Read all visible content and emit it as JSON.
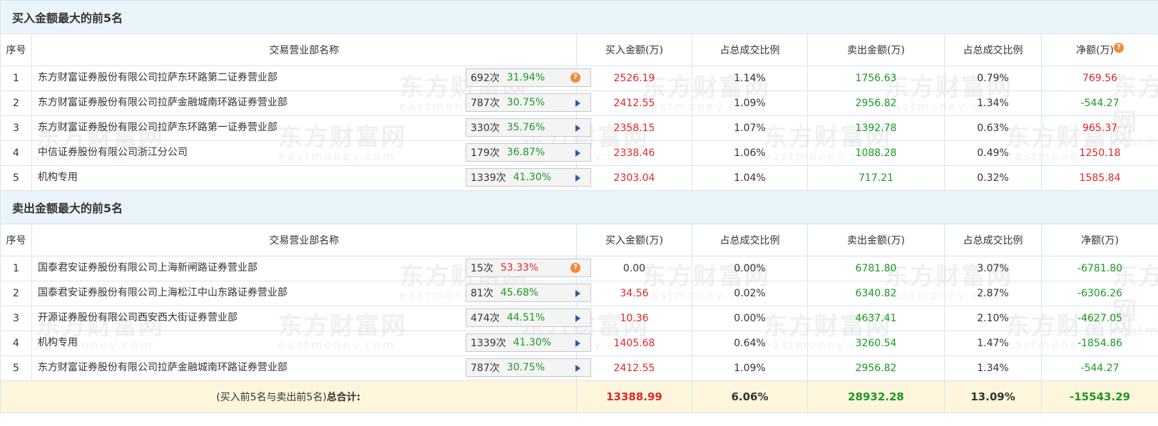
{
  "buy_section": {
    "title": "买入金额最大的前5名",
    "headers": [
      "序号",
      "交易营业部名称",
      "买入金额(万)",
      "占总成交比例",
      "卖出金额(万)",
      "占总成交比例",
      "净额(万)"
    ],
    "rows": [
      {
        "idx": "1",
        "name": "东方财富证券股份有限公司拉萨东环路第二证券营业部",
        "count": "692次",
        "pct": "31.94%",
        "icon": "question-icon",
        "buy": "2526.19",
        "buy_ratio": "1.14%",
        "sell": "1756.63",
        "sell_ratio": "0.79%",
        "net": "769.56"
      },
      {
        "idx": "2",
        "name": "东方财富证券股份有限公司拉萨金融城南环路证券营业部",
        "count": "787次",
        "pct": "30.75%",
        "icon": "play-arrow-icon",
        "buy": "2412.55",
        "buy_ratio": "1.09%",
        "sell": "2956.82",
        "sell_ratio": "1.34%",
        "net": "-544.27"
      },
      {
        "idx": "3",
        "name": "东方财富证券股份有限公司拉萨东环路第一证券营业部",
        "count": "330次",
        "pct": "35.76%",
        "icon": "play-arrow-icon",
        "buy": "2358.15",
        "buy_ratio": "1.07%",
        "sell": "1392.78",
        "sell_ratio": "0.63%",
        "net": "965.37"
      },
      {
        "idx": "4",
        "name": "中信证券股份有限公司浙江分公司",
        "count": "179次",
        "pct": "36.87%",
        "icon": "play-arrow-icon",
        "buy": "2338.46",
        "buy_ratio": "1.06%",
        "sell": "1088.28",
        "sell_ratio": "0.49%",
        "net": "1250.18"
      },
      {
        "idx": "5",
        "name": "机构专用",
        "count": "1339次",
        "pct": "41.30%",
        "icon": "play-arrow-icon",
        "buy": "2303.04",
        "buy_ratio": "1.04%",
        "sell": "717.21",
        "sell_ratio": "0.32%",
        "net": "1585.84"
      }
    ]
  },
  "sell_section": {
    "title": "卖出金额最大的前5名",
    "headers": [
      "序号",
      "交易营业部名称",
      "买入金额(万)",
      "占总成交比例",
      "卖出金额(万)",
      "占总成交比例",
      "净额(万)"
    ],
    "rows": [
      {
        "idx": "1",
        "name": "国泰君安证券股份有限公司上海新闸路证券营业部",
        "count": "15次",
        "pct": "53.33%",
        "icon": "question-icon",
        "buy": "0.00",
        "buy_ratio": "0.00%",
        "sell": "6781.80",
        "sell_ratio": "3.07%",
        "net": "-6781.80"
      },
      {
        "idx": "2",
        "name": "国泰君安证券股份有限公司上海松江中山东路证券营业部",
        "count": "81次",
        "pct": "45.68%",
        "icon": "play-arrow-icon",
        "buy": "34.56",
        "buy_ratio": "0.02%",
        "sell": "6340.82",
        "sell_ratio": "2.87%",
        "net": "-6306.26"
      },
      {
        "idx": "3",
        "name": "开源证券股份有限公司西安西大街证券营业部",
        "count": "474次",
        "pct": "44.51%",
        "icon": "play-arrow-icon",
        "buy": "10.36",
        "buy_ratio": "0.00%",
        "sell": "4637.41",
        "sell_ratio": "2.10%",
        "net": "-4627.05"
      },
      {
        "idx": "4",
        "name": "机构专用",
        "count": "1339次",
        "pct": "41.30%",
        "icon": "play-arrow-icon",
        "buy": "1405.68",
        "buy_ratio": "0.64%",
        "sell": "3260.54",
        "sell_ratio": "1.47%",
        "net": "-1854.86"
      },
      {
        "idx": "5",
        "name": "东方财富证券股份有限公司拉萨金融城南环路证券营业部",
        "count": "787次",
        "pct": "30.75%",
        "icon": "play-arrow-icon",
        "buy": "2412.55",
        "buy_ratio": "1.09%",
        "sell": "2956.82",
        "sell_ratio": "1.34%",
        "net": "-544.27"
      }
    ]
  },
  "total": {
    "label_prefix": "(买入前5名与卖出前5名)",
    "label_bold": "总合计:",
    "buy": "13388.99",
    "buy_ratio": "6.06%",
    "sell": "28932.28",
    "sell_ratio": "13.09%",
    "net": "-15543.29"
  },
  "watermark": {
    "cn": "东方财富网",
    "en": "eastmoney.com"
  },
  "colors": {
    "positive": "#e0282a",
    "negative": "#1a9a22",
    "section_bg": "#eaf4fb",
    "total_bg": "#fdf6dc",
    "border": "#d6e4ef"
  }
}
